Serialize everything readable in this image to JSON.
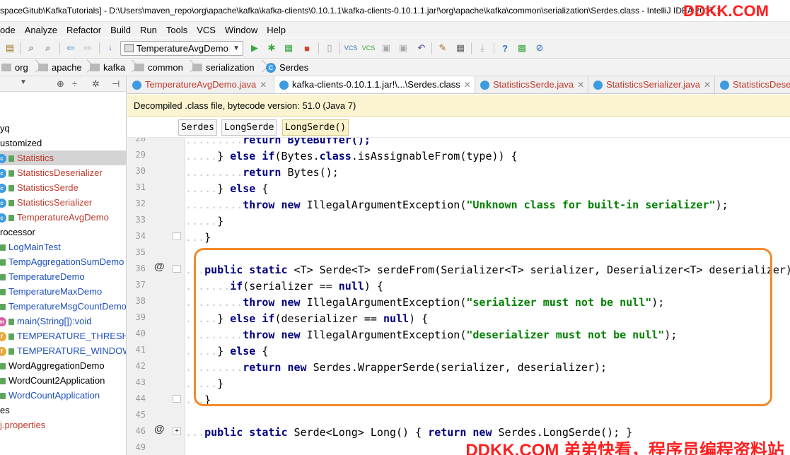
{
  "window": {
    "title": "spaceGitub\\KafkaTutorials] - D:\\Users\\maven_repo\\org\\apache\\kafka\\kafka-clients\\0.10.1.1\\kafka-clients-0.10.1.1.jar!\\org\\apache\\kafka\\common\\serialization\\Serdes.class - IntelliJ IDEA 2017.1",
    "watermark_top": "DDKK.COM"
  },
  "menu": [
    "ode",
    "Analyze",
    "Refactor",
    "Build",
    "Run",
    "Tools",
    "VCS",
    "Window",
    "Help"
  ],
  "toolbar": {
    "run_config": "TemperatureAvgDemo"
  },
  "breadcrumb": [
    "org",
    "apache",
    "kafka",
    "common",
    "serialization",
    "Serdes"
  ],
  "project_tree": [
    {
      "label": "yq",
      "icon": "none",
      "color": "#000000",
      "selected": false
    },
    {
      "label": "ustomized",
      "icon": "none",
      "color": "#000000",
      "selected": false
    },
    {
      "label": "Statistics",
      "icon": "class",
      "color": "#c0392b",
      "selected": true
    },
    {
      "label": "StatisticsDeserializer",
      "icon": "class",
      "color": "#c0392b",
      "selected": false
    },
    {
      "label": "StatisticsSerde",
      "icon": "class",
      "color": "#c0392b",
      "selected": false
    },
    {
      "label": "StatisticsSerializer",
      "icon": "class",
      "color": "#c0392b",
      "selected": false
    },
    {
      "label": "TemperatureAvgDemo",
      "icon": "class",
      "color": "#c0392b",
      "selected": false
    },
    {
      "label": "rocessor",
      "icon": "none",
      "color": "#000000",
      "selected": false
    },
    {
      "label": "LogMainTest",
      "icon": "none",
      "color": "#1d4fbf",
      "selected": false
    },
    {
      "label": "TempAggregationSumDemo",
      "icon": "none",
      "color": "#1d4fbf",
      "selected": false
    },
    {
      "label": "TemperatureDemo",
      "icon": "none",
      "color": "#1d4fbf",
      "selected": false
    },
    {
      "label": "TemperatureMaxDemo",
      "icon": "none",
      "color": "#1d4fbf",
      "selected": false
    },
    {
      "label": "TemperatureMsgCountDemo",
      "icon": "none",
      "color": "#1d4fbf",
      "selected": false
    },
    {
      "label": "main(String[]):void",
      "icon": "method",
      "color": "#1d4fbf",
      "selected": false
    },
    {
      "label": "TEMPERATURE_THRESHO",
      "icon": "field",
      "color": "#1d4fbf",
      "selected": false
    },
    {
      "label": "TEMPERATURE_WINDOW",
      "icon": "field",
      "color": "#1d4fbf",
      "selected": false
    },
    {
      "label": "WordAggregationDemo",
      "icon": "none",
      "color": "#000000",
      "selected": false
    },
    {
      "label": "WordCount2Application",
      "icon": "none",
      "color": "#000000",
      "selected": false
    },
    {
      "label": "WordCountApplication",
      "icon": "none",
      "color": "#1d4fbf",
      "selected": false
    },
    {
      "label": "es",
      "icon": "none",
      "color": "#000000",
      "selected": false
    },
    {
      "label": "j.properties",
      "icon": "none",
      "color": "#c0392b",
      "selected": false
    }
  ],
  "tabs": [
    {
      "label": "TemperatureAvgDemo.java",
      "color": "#c0392b",
      "active": false
    },
    {
      "label": "kafka-clients-0.10.1.1.jar!\\...\\Serdes.class",
      "color": "#000000",
      "active": true
    },
    {
      "label": "StatisticsSerde.java",
      "color": "#c0392b",
      "active": false
    },
    {
      "label": "StatisticsSerializer.java",
      "color": "#c0392b",
      "active": false
    },
    {
      "label": "StatisticsDese",
      "color": "#c0392b",
      "active": false
    }
  ],
  "banner": "Decompiled .class file, bytecode version: 51.0 (Java 7)",
  "code_breadcrumb": [
    "Serdes",
    "LongSerde",
    "LongSerde()"
  ],
  "gutter": {
    "line_numbers": [
      "28",
      "29",
      "30",
      "31",
      "32",
      "33",
      "34",
      "35",
      "36",
      "37",
      "38",
      "39",
      "40",
      "41",
      "42",
      "43",
      "44",
      "45",
      "46",
      "49"
    ],
    "override_mark": "@"
  },
  "code": {
    "l28": "return ByteBuffer();",
    "l29_pre": "} ",
    "l29_kw1": "else if",
    "l29_mid": "(Bytes.",
    "l29_kw2": "class",
    "l29_post": ".isAssignableFrom(type)) {",
    "l30_kw": "return",
    "l30_post": " Bytes();",
    "l31_pre": "} ",
    "l31_kw": "else",
    "l31_post": " {",
    "l32_kw1": "throw",
    "l32_kw2": "new",
    "l32_mid": " IllegalArgumentException(",
    "l32_str": "\"Unknown class for built-in serializer\"",
    "l32_post": ");",
    "l33": "}",
    "l34": "}",
    "l36_kw1": "public static",
    "l36_post": " <T> Serde<T> serdeFrom(Serializer<T> serializer, Deserializer<T> deserializer) {",
    "l37_kw": "if",
    "l37_mid": "(serializer == ",
    "l37_kw2": "null",
    "l37_post": ") {",
    "l38_kw1": "throw",
    "l38_kw2": "new",
    "l38_mid": " IllegalArgumentException(",
    "l38_str": "\"serializer must not be null\"",
    "l38_post": ");",
    "l39_pre": "} ",
    "l39_kw": "else if",
    "l39_mid": "(deserializer == ",
    "l39_kw2": "null",
    "l39_post": ") {",
    "l40_kw1": "throw",
    "l40_kw2": "new",
    "l40_mid": " IllegalArgumentException(",
    "l40_str": "\"deserializer must not be null\"",
    "l40_post": ");",
    "l41_pre": "} ",
    "l41_kw": "else",
    "l41_post": " {",
    "l42_kw1": "return",
    "l42_kw2": "new",
    "l42_post": " Serdes.WrapperSerde(serializer, deserializer);",
    "l43": "}",
    "l44": "}",
    "l46_kw1": "public static",
    "l46_mid": " Serde<Long> Long() { ",
    "l46_kw2": "return",
    "l46_kw3": "new",
    "l46_post": " Serdes.LongSerde(); }"
  },
  "watermark_bottom": "DDKK.COM 弟弟快看，程序员编程资料站"
}
